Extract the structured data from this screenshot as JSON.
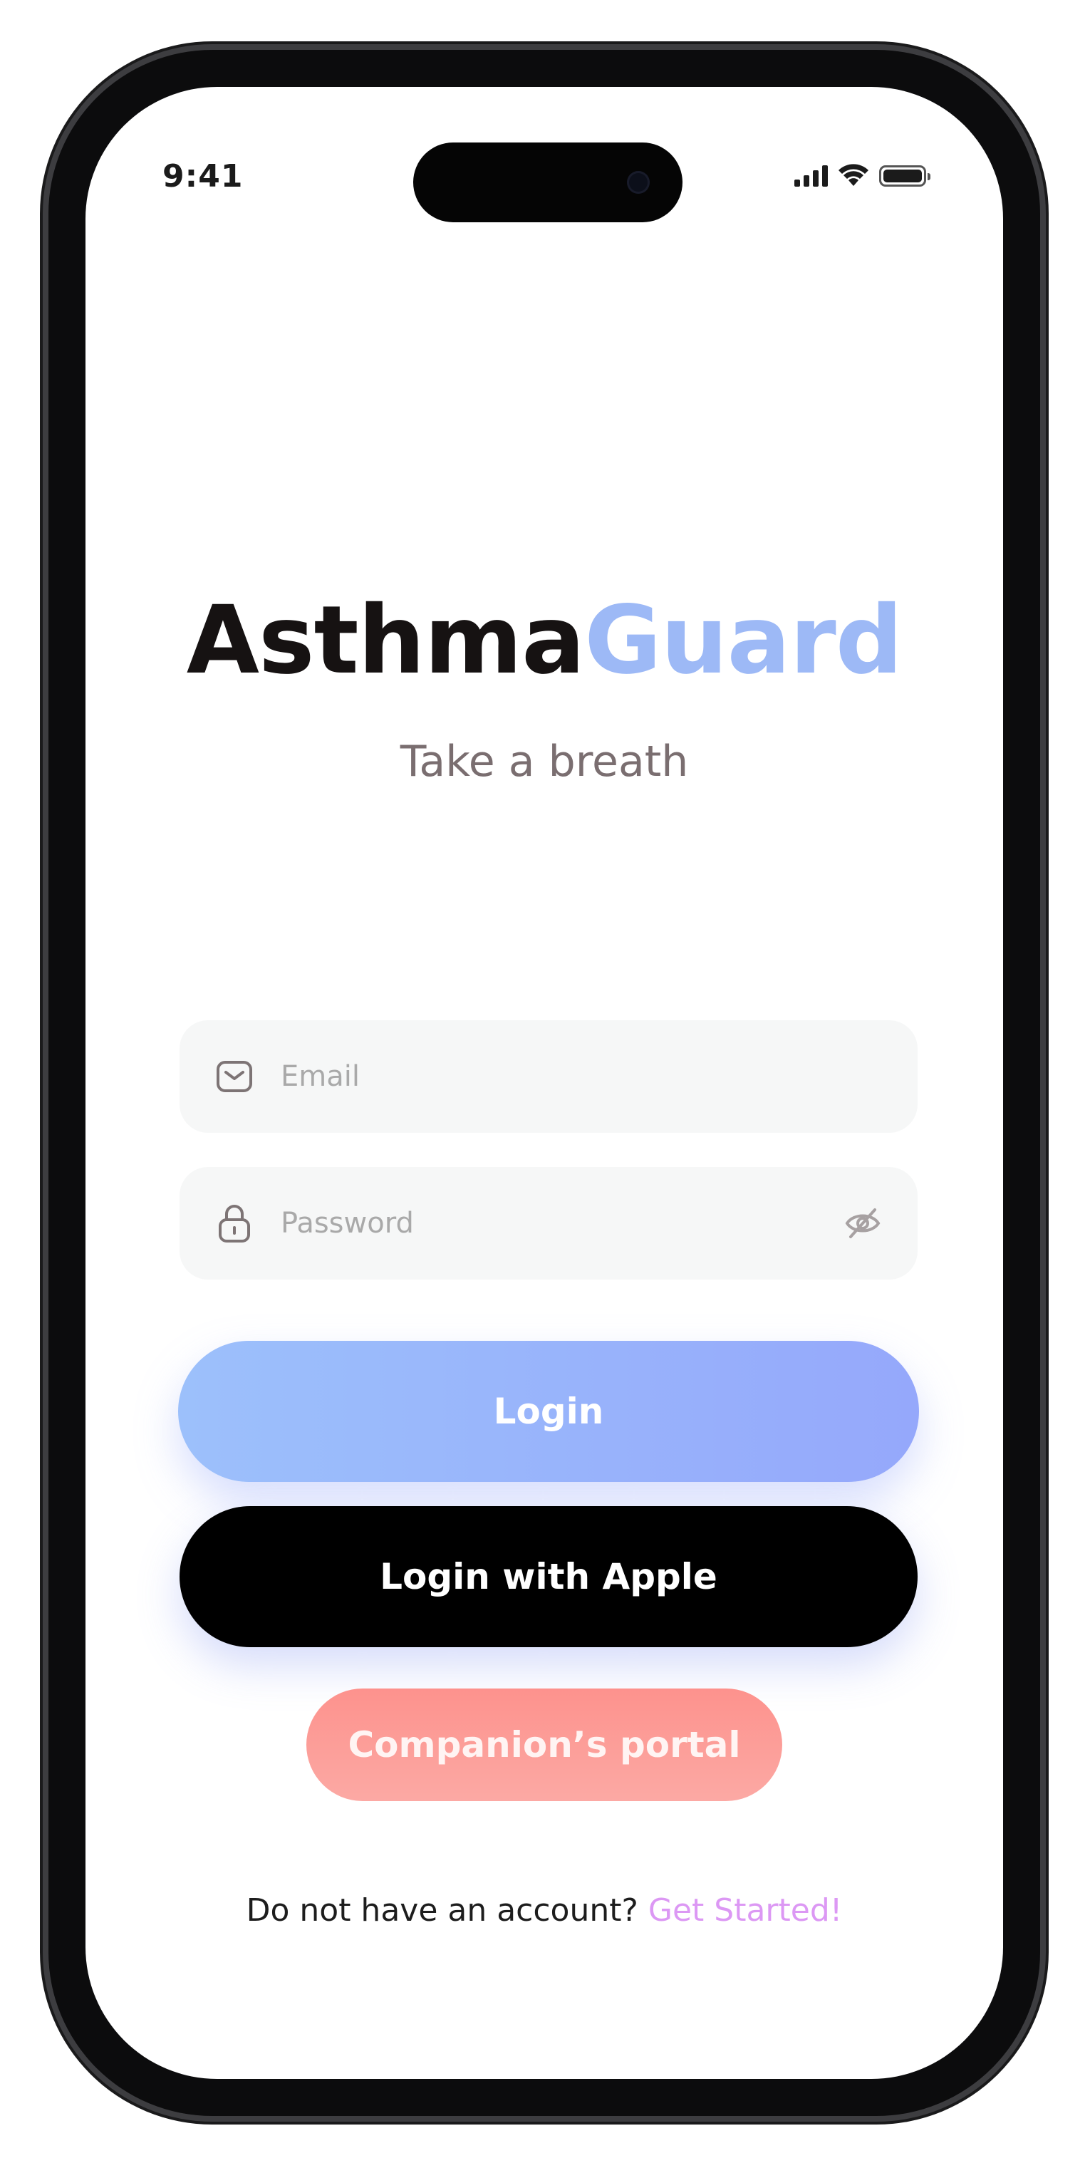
{
  "status_bar": {
    "time": "9:41",
    "icons": [
      "cellular-signal-icon",
      "wifi-icon",
      "battery-icon"
    ]
  },
  "brand": {
    "name_part1": "Asthma",
    "name_part2": "Guard",
    "tagline": "Take a breath",
    "colors": {
      "dark": "#161212",
      "accent": "#9db9f6"
    }
  },
  "form": {
    "email": {
      "placeholder": "Email",
      "value": "",
      "icon": "mail-icon"
    },
    "password": {
      "placeholder": "Password",
      "value": "",
      "icon": "lock-icon",
      "toggle_icon": "eye-off-icon"
    }
  },
  "buttons": {
    "login": "Login",
    "login_apple": "Login with Apple",
    "companion": "Companion’s portal"
  },
  "footer": {
    "prompt": "Do not have an account?",
    "link": "Get Started!"
  },
  "colors": {
    "login_gradient_start": "#9cc0fb",
    "login_gradient_end": "#95a8fb",
    "apple_button": "#000000",
    "companion_gradient_start": "#fd928d",
    "companion_gradient_end": "#fca9a4",
    "link": "#dc98f4"
  }
}
